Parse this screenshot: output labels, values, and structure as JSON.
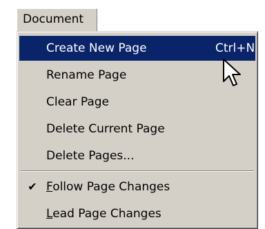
{
  "menubar": {
    "document_label": "Document"
  },
  "menu": {
    "items": [
      {
        "label": "Create New Page",
        "shortcut": "Ctrl+N",
        "highlighted": true
      },
      {
        "label": "Rename Page"
      },
      {
        "label": "Clear Page"
      },
      {
        "label": "Delete Current Page"
      },
      {
        "label": "Delete Pages..."
      },
      {
        "label": "Follow Page Changes",
        "checked": true,
        "mnemonic": "F"
      },
      {
        "label": "Lead Page Changes",
        "mnemonic": "L"
      }
    ]
  },
  "colors": {
    "menu_background": "#d4d0c8",
    "highlight": "#0a246a",
    "highlight_text": "#ffffff"
  },
  "icons": {
    "check": "checkmark-icon",
    "cursor": "mouse-pointer-icon"
  }
}
